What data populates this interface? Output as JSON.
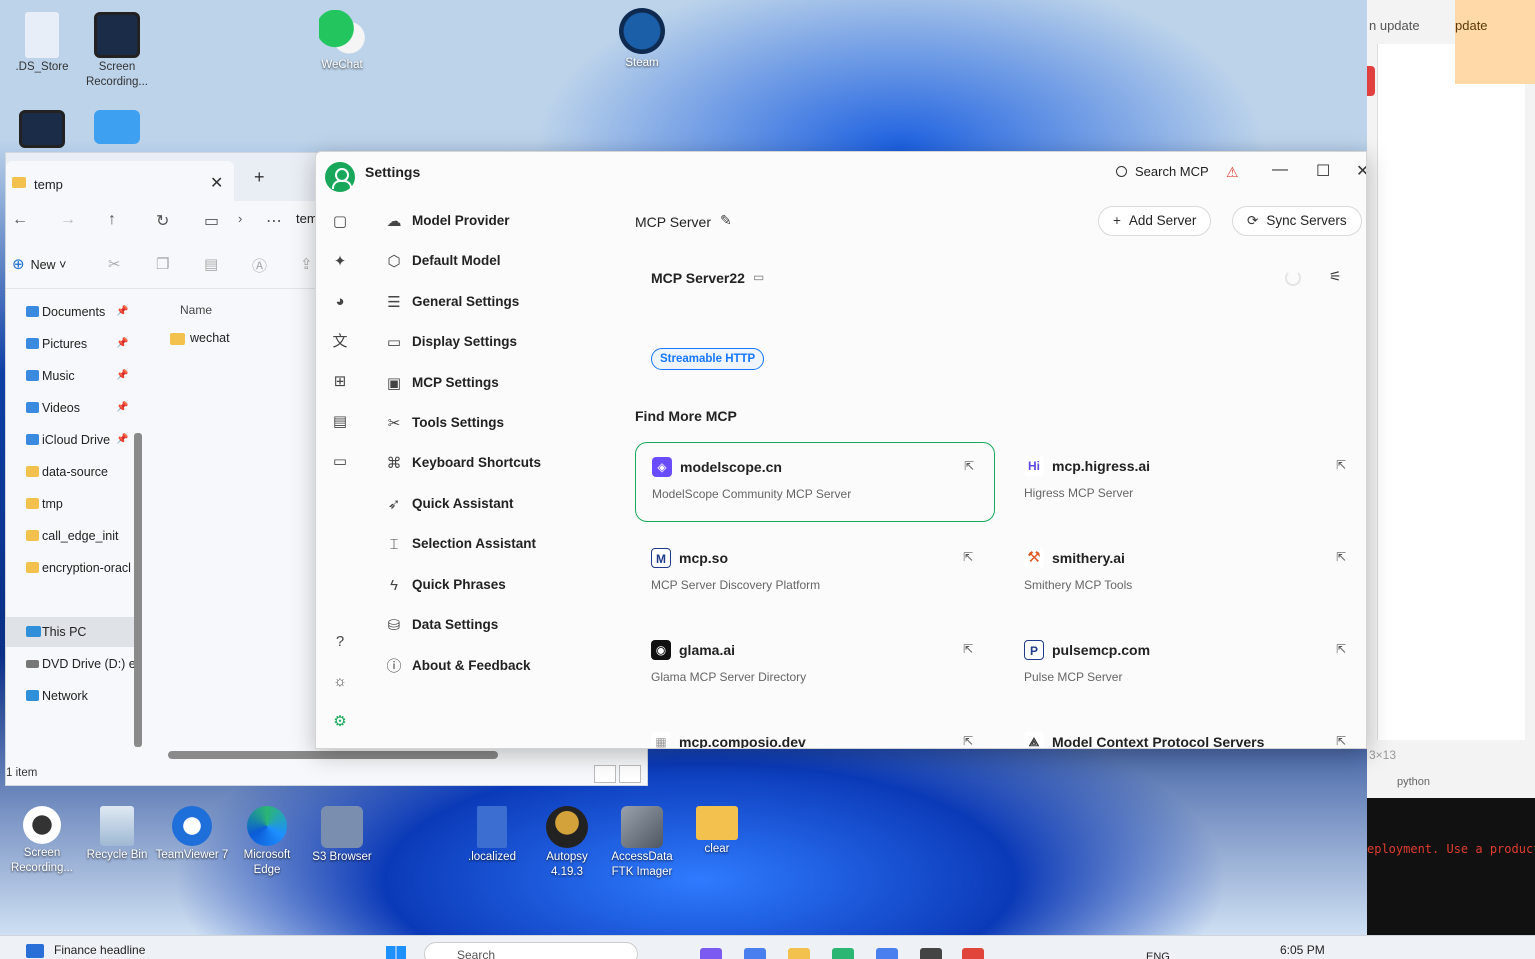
{
  "desktop": {
    "top_icons": [
      {
        "label": ".DS_Store"
      },
      {
        "label": "Screen Recording..."
      },
      {
        "label": "WeChat"
      },
      {
        "label": "Steam"
      }
    ],
    "bottom_icons": [
      {
        "label": "Screen Recording..."
      },
      {
        "label": "Recycle Bin"
      },
      {
        "label": "TeamViewer 7"
      },
      {
        "label": "Microsoft Edge"
      },
      {
        "label": "S3 Browser"
      },
      {
        "label": ".localized"
      },
      {
        "label": "Autopsy 4.19.3"
      },
      {
        "label": "AccessData FTK Imager"
      },
      {
        "label": "clear"
      }
    ]
  },
  "background_window": {
    "update_label_1": "n update",
    "update_label_2": "pdate",
    "dimension_text": "3×13",
    "python_label": "python",
    "terminal_text": "eployment. Use a product"
  },
  "explorer": {
    "tab_title": "temp",
    "new_label": "New",
    "path_fragment": "tem",
    "sidebar": [
      {
        "label": "Documents",
        "pinned": true,
        "color": "#3a8be0"
      },
      {
        "label": "Pictures",
        "pinned": true,
        "color": "#3a8be0"
      },
      {
        "label": "Music",
        "pinned": true,
        "color": "#3a8be0"
      },
      {
        "label": "Videos",
        "pinned": true,
        "color": "#3a8be0"
      },
      {
        "label": "iCloud Drive",
        "pinned": true,
        "color": "#3a8be0"
      },
      {
        "label": "data-source",
        "pinned": false,
        "color": "#f2c14e"
      },
      {
        "label": "tmp",
        "pinned": false,
        "color": "#f2c14e"
      },
      {
        "label": "call_edge_init",
        "pinned": false,
        "color": "#f2c14e"
      },
      {
        "label": "encryption-oracl",
        "pinned": false,
        "color": "#f2c14e"
      }
    ],
    "locations": [
      {
        "label": "This PC",
        "selected": true
      },
      {
        "label": "DVD Drive (D:) e",
        "selected": false
      },
      {
        "label": "Network",
        "selected": false
      }
    ],
    "column_header": "Name",
    "files": [
      {
        "name": "wechat"
      }
    ],
    "status": "1 item"
  },
  "settings": {
    "title": "Settings",
    "search_label": "Search MCP",
    "menu": [
      {
        "label": "Model Provider",
        "icon": "cloud-icon",
        "glyph": "☁"
      },
      {
        "label": "Default Model",
        "icon": "cube-icon",
        "glyph": "⬡"
      },
      {
        "label": "General Settings",
        "icon": "sliders-icon",
        "glyph": "☰"
      },
      {
        "label": "Display Settings",
        "icon": "monitor-icon",
        "glyph": "▭"
      },
      {
        "label": "MCP Settings",
        "icon": "terminal-icon",
        "glyph": "▣"
      },
      {
        "label": "Tools Settings",
        "icon": "wrench-icon",
        "glyph": "✂"
      },
      {
        "label": "Keyboard Shortcuts",
        "icon": "command-icon",
        "glyph": "⌘"
      },
      {
        "label": "Quick Assistant",
        "icon": "rocket-icon",
        "glyph": "➶"
      },
      {
        "label": "Selection Assistant",
        "icon": "text-select-icon",
        "glyph": "⌶"
      },
      {
        "label": "Quick Phrases",
        "icon": "zap-icon",
        "glyph": "ϟ"
      },
      {
        "label": "Data Settings",
        "icon": "hard-drive-icon",
        "glyph": "⛁"
      },
      {
        "label": "About & Feedback",
        "icon": "info-icon",
        "glyph": "ⓘ"
      }
    ],
    "header_title": "MCP Server",
    "add_server_label": "Add Server",
    "sync_servers_label": "Sync Servers",
    "server": {
      "name": "MCP Server22",
      "type": "Streamable HTTP"
    },
    "find_more_title": "Find More MCP",
    "sites": [
      {
        "name": "modelscope.cn",
        "desc": "ModelScope Community MCP Server",
        "logo": "◈",
        "logo_bg": "#6a4cff",
        "logo_fg": "#ffffff"
      },
      {
        "name": "mcp.higress.ai",
        "desc": "Higress MCP Server",
        "logo": "Hi",
        "logo_bg": "#ffffff",
        "logo_fg": "#5b4be0"
      },
      {
        "name": "mcp.so",
        "desc": "MCP Server Discovery Platform",
        "logo": "M",
        "logo_bg": "#ffffff",
        "logo_fg": "#1f3a8a"
      },
      {
        "name": "smithery.ai",
        "desc": "Smithery MCP Tools",
        "logo": "⚒",
        "logo_bg": "#ffffff",
        "logo_fg": "#e0561f"
      },
      {
        "name": "glama.ai",
        "desc": "Glama MCP Server Directory",
        "logo": "◉",
        "logo_bg": "#111111",
        "logo_fg": "#ffffff"
      },
      {
        "name": "pulsemcp.com",
        "desc": "Pulse MCP Server",
        "logo": "P",
        "logo_bg": "#ffffff",
        "logo_fg": "#1f3a8a"
      },
      {
        "name": "mcp.composio.dev",
        "desc": "",
        "logo": "▦",
        "logo_bg": "#ffffff",
        "logo_fg": "#999999"
      },
      {
        "name": "Model Context Protocol Servers",
        "desc": "",
        "logo": "⟁",
        "logo_bg": "#ffffff",
        "logo_fg": "#333333"
      }
    ],
    "accent_color": "#19a85b",
    "tag_color": "#1677ff"
  },
  "taskbar": {
    "news": "Finance headline",
    "search_placeholder": "Search",
    "language": "ENG",
    "time": "6:05 PM"
  }
}
